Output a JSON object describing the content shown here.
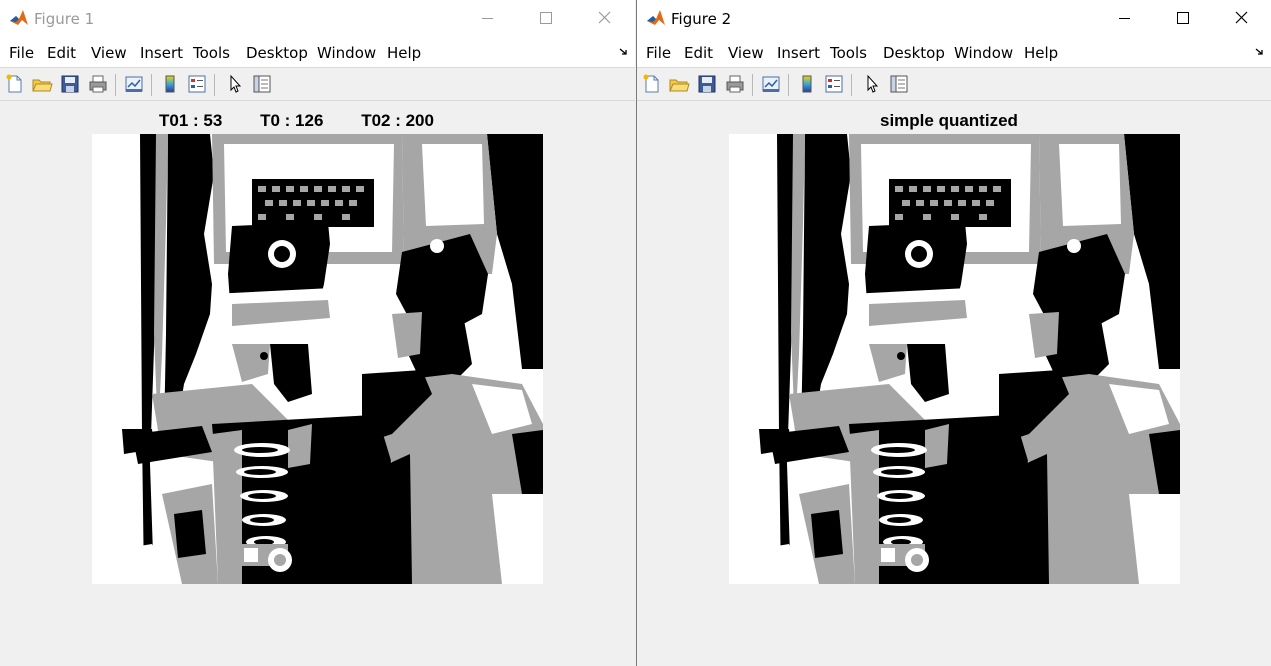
{
  "windows": [
    {
      "title": "Figure 1",
      "menu": [
        "File",
        "Edit",
        "View",
        "Insert",
        "Tools",
        "Desktop",
        "Window",
        "Help"
      ],
      "axes_title": "T01 : 53        T0 : 126        T02 : 200",
      "image_alt": "Three-level quantized grayscale photo (black, gray, white) of a drummer-boy soldier figure with shako hat, cross-belt uniform with buttons, and a dark-capped figure beside him"
    },
    {
      "title": "Figure 2",
      "menu": [
        "File",
        "Edit",
        "View",
        "Insert",
        "Tools",
        "Desktop",
        "Window",
        "Help"
      ],
      "axes_title": "simple quantized",
      "image_alt": "Three-level quantized grayscale photo (black, gray, white) of a drummer-boy soldier figure with shako hat, cross-belt uniform with buttons, and a dark-capped figure beside him"
    }
  ],
  "toolbar_icons": [
    "new-figure-icon",
    "open-file-icon",
    "save-icon",
    "print-icon",
    "link-plot-icon",
    "insert-colorbar-icon",
    "insert-legend-icon",
    "edit-plot-arrow-icon",
    "property-inspector-icon"
  ],
  "colors": {
    "quant_black": "#000000",
    "quant_gray": "#a6a6a6",
    "quant_white": "#ffffff",
    "matlab_orange": "#e16a13",
    "matlab_blue": "#1f5fa8"
  }
}
